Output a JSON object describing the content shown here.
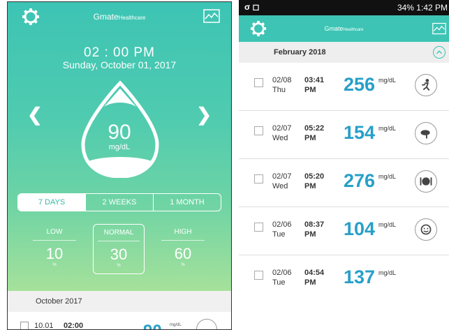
{
  "left": {
    "header": {
      "logo": "Gmate",
      "logo_sub": "Healthcare"
    },
    "time": "02 : 00 PM",
    "date": "Sunday, October 01, 2017",
    "glucose": {
      "value": "90",
      "unit": "mg/dL"
    },
    "tabs": [
      "7 DAYS",
      "2 WEEKS",
      "1 MONTH"
    ],
    "stats": [
      {
        "label": "LOW",
        "value": "10",
        "unit": "%"
      },
      {
        "label": "NORMAL",
        "value": "30",
        "unit": "%"
      },
      {
        "label": "HIGH",
        "value": "60",
        "unit": "%"
      }
    ],
    "month": "October 2017",
    "row": {
      "date": "10.01",
      "time": "02:00",
      "value": "90",
      "unit": "mg/dL"
    }
  },
  "right": {
    "status_bar": {
      "left": "σ ◻",
      "right": "34% 1:42 PM"
    },
    "header": {
      "logo": "Gmate",
      "logo_sub": "Healthcare"
    },
    "month": "February 2018",
    "rows": [
      {
        "date": "02/08",
        "day": "Thu",
        "time": "03:41",
        "ampm": "PM",
        "value": "256",
        "unit": "mg/dL",
        "icon": "exercise-icon"
      },
      {
        "date": "02/07",
        "day": "Wed",
        "time": "05:22",
        "ampm": "PM",
        "value": "154",
        "unit": "mg/dL",
        "icon": "medicine-icon"
      },
      {
        "date": "02/07",
        "day": "Wed",
        "time": "05:20",
        "ampm": "PM",
        "value": "276",
        "unit": "mg/dL",
        "icon": "meal-icon"
      },
      {
        "date": "02/06",
        "day": "Tue",
        "time": "08:37",
        "ampm": "PM",
        "value": "104",
        "unit": "mg/dL",
        "icon": "mood-icon"
      },
      {
        "date": "02/06",
        "day": "Tue",
        "time": "04:54",
        "ampm": "PM",
        "value": "137",
        "unit": "mg/dL",
        "icon": ""
      }
    ]
  },
  "colors": {
    "accent": "#3dc4b4",
    "value": "#27a0c8"
  }
}
